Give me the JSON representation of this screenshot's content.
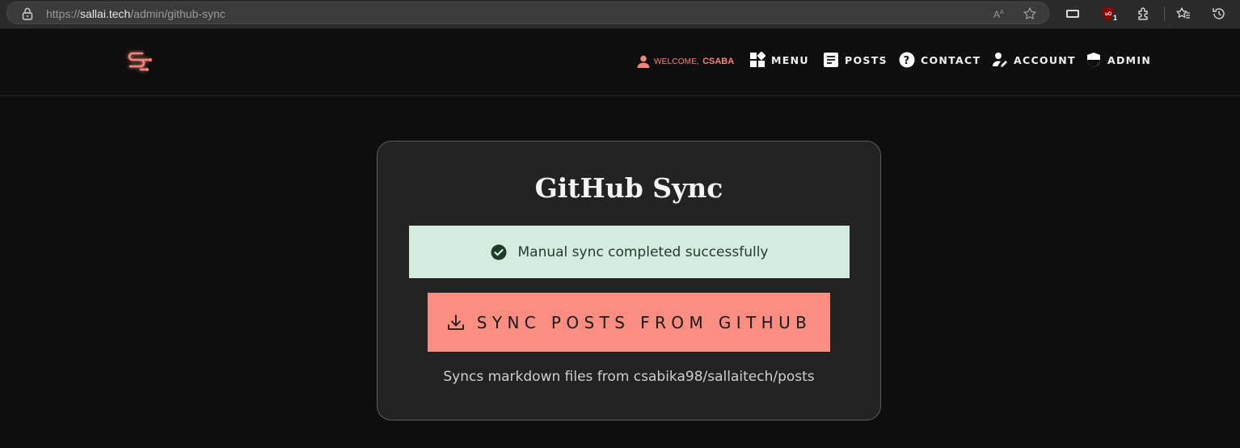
{
  "browser": {
    "url_prefix": "https://",
    "url_host": "sallai.tech",
    "url_path": "/admin/github-sync",
    "extension_badge": "1"
  },
  "header": {
    "welcome_label": "WELCOME,",
    "user_name": "CSABA",
    "nav": {
      "menu": "MENU",
      "posts": "POSTS",
      "contact": "CONTACT",
      "account": "ACCOUNT",
      "admin": "ADMIN"
    }
  },
  "main": {
    "title": "GitHub Sync",
    "alert_message": "Manual sync completed successfully",
    "sync_button_label": "SYNC POSTS FROM GITHUB",
    "note": "Syncs markdown files from csabika98/sallaitech/posts"
  },
  "colors": {
    "accent": "#fc8d81",
    "success_bg": "#d4ece0",
    "success_icon": "#1d3b2a",
    "page_bg": "#0e0e0e",
    "card_bg": "#232323"
  },
  "icons": {
    "logo": "sallai-logo",
    "alert": "check-circle-icon",
    "sync_button": "download-icon"
  }
}
